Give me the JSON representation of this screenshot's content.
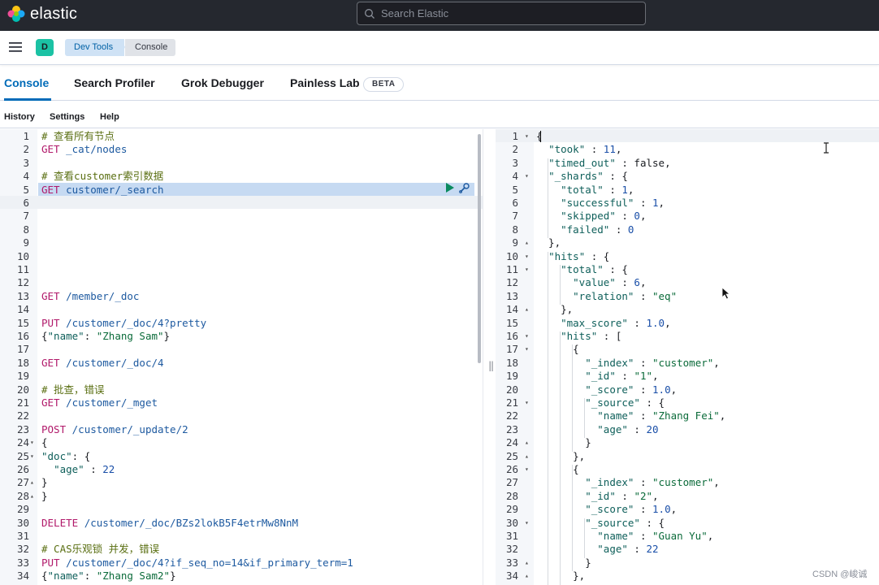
{
  "header": {
    "brand": "elastic",
    "search_placeholder": "Search Elastic"
  },
  "breadcrumbs": {
    "space_initial": "D",
    "items": [
      "Dev Tools",
      "Console"
    ]
  },
  "tabs": [
    {
      "label": "Console",
      "active": true
    },
    {
      "label": "Search Profiler",
      "active": false
    },
    {
      "label": "Grok Debugger",
      "active": false
    },
    {
      "label": "Painless Lab",
      "active": false
    }
  ],
  "beta_badge": "BETA",
  "menu": [
    "History",
    "Settings",
    "Help"
  ],
  "resizer_handle": "‖",
  "watermark": "CSDN @峻诚",
  "colors": {
    "topbar": "#25282f",
    "accent": "#006bb8",
    "selection": "#c6daf2",
    "space_badge": "#1bc2a4"
  },
  "editor": {
    "lines": [
      {
        "n": "1",
        "text": "# 查看所有节点"
      },
      {
        "n": "2",
        "text": "GET _cat/nodes"
      },
      {
        "n": "3",
        "text": ""
      },
      {
        "n": "4",
        "text": "# 查看customer索引数据"
      },
      {
        "n": "5",
        "text": "GET customer/_search"
      },
      {
        "n": "6",
        "text": ""
      },
      {
        "n": "7",
        "text": ""
      },
      {
        "n": "8",
        "text": ""
      },
      {
        "n": "9",
        "text": ""
      },
      {
        "n": "10",
        "text": ""
      },
      {
        "n": "11",
        "text": ""
      },
      {
        "n": "12",
        "text": ""
      },
      {
        "n": "13",
        "text": "GET /member/_doc"
      },
      {
        "n": "14",
        "text": ""
      },
      {
        "n": "15",
        "text": "PUT /customer/_doc/4?pretty"
      },
      {
        "n": "16",
        "text": "{\"name\": \"Zhang Sam\"}"
      },
      {
        "n": "17",
        "text": ""
      },
      {
        "n": "18",
        "text": "GET /customer/_doc/4"
      },
      {
        "n": "19",
        "text": ""
      },
      {
        "n": "20",
        "text": "# 批查，错误"
      },
      {
        "n": "21",
        "text": "GET /customer/_mget"
      },
      {
        "n": "22",
        "text": ""
      },
      {
        "n": "23",
        "text": "POST /customer/_update/2"
      },
      {
        "n": "24",
        "text": "{"
      },
      {
        "n": "25",
        "text": "\"doc\": {"
      },
      {
        "n": "26",
        "text": "  \"age\" : 22"
      },
      {
        "n": "27",
        "text": "}"
      },
      {
        "n": "28",
        "text": "}"
      },
      {
        "n": "29",
        "text": ""
      },
      {
        "n": "30",
        "text": "DELETE /customer/_doc/BZs2lokB5F4etrMw8NnM"
      },
      {
        "n": "31",
        "text": ""
      },
      {
        "n": "32",
        "text": "# CAS乐观锁 并发，错误"
      },
      {
        "n": "33",
        "text": "PUT /customer/_doc/4?if_seq_no=14&if_primary_term=1"
      },
      {
        "n": "34",
        "text": "{\"name\": \"Zhang Sam2\"}"
      }
    ]
  },
  "output": {
    "lines": [
      {
        "n": "1",
        "text": "{"
      },
      {
        "n": "2",
        "text": "  \"took\" : 11,"
      },
      {
        "n": "3",
        "text": "  \"timed_out\" : false,"
      },
      {
        "n": "4",
        "text": "  \"_shards\" : {"
      },
      {
        "n": "5",
        "text": "    \"total\" : 1,"
      },
      {
        "n": "6",
        "text": "    \"successful\" : 1,"
      },
      {
        "n": "7",
        "text": "    \"skipped\" : 0,"
      },
      {
        "n": "8",
        "text": "    \"failed\" : 0"
      },
      {
        "n": "9",
        "text": "  },"
      },
      {
        "n": "10",
        "text": "  \"hits\" : {"
      },
      {
        "n": "11",
        "text": "    \"total\" : {"
      },
      {
        "n": "12",
        "text": "      \"value\" : 6,"
      },
      {
        "n": "13",
        "text": "      \"relation\" : \"eq\""
      },
      {
        "n": "14",
        "text": "    },"
      },
      {
        "n": "15",
        "text": "    \"max_score\" : 1.0,"
      },
      {
        "n": "16",
        "text": "    \"hits\" : ["
      },
      {
        "n": "17",
        "text": "      {"
      },
      {
        "n": "18",
        "text": "        \"_index\" : \"customer\","
      },
      {
        "n": "19",
        "text": "        \"_id\" : \"1\","
      },
      {
        "n": "20",
        "text": "        \"_score\" : 1.0,"
      },
      {
        "n": "21",
        "text": "        \"_source\" : {"
      },
      {
        "n": "22",
        "text": "          \"name\" : \"Zhang Fei\","
      },
      {
        "n": "23",
        "text": "          \"age\" : 20"
      },
      {
        "n": "24",
        "text": "        }"
      },
      {
        "n": "25",
        "text": "      },"
      },
      {
        "n": "26",
        "text": "      {"
      },
      {
        "n": "27",
        "text": "        \"_index\" : \"customer\","
      },
      {
        "n": "28",
        "text": "        \"_id\" : \"2\","
      },
      {
        "n": "29",
        "text": "        \"_score\" : 1.0,"
      },
      {
        "n": "30",
        "text": "        \"_source\" : {"
      },
      {
        "n": "31",
        "text": "          \"name\" : \"Guan Yu\","
      },
      {
        "n": "32",
        "text": "          \"age\" : 22"
      },
      {
        "n": "33",
        "text": "        }"
      },
      {
        "n": "34",
        "text": "      },"
      }
    ]
  }
}
